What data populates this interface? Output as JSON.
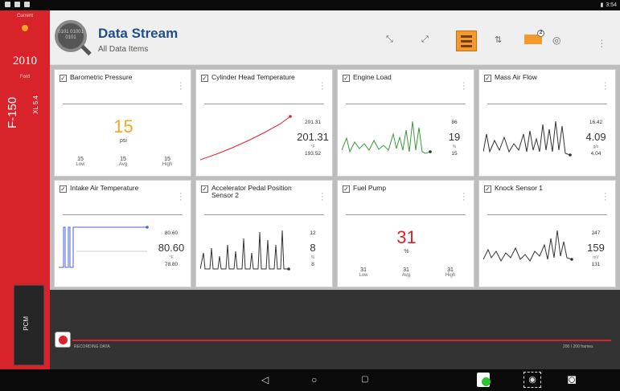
{
  "status_bar": {
    "time": "3:54"
  },
  "sidebar": {
    "current_label": "Current",
    "year": "2010",
    "make": "Ford",
    "model": "F-150",
    "engine": "XL 5.4",
    "module_tab": "PCM"
  },
  "header": {
    "title": "Data Stream",
    "subtitle": "All Data Items",
    "logo_text": "0101 01001 0101",
    "camera_badge": "2"
  },
  "cards": [
    {
      "label": "Barometric Pressure",
      "type": "gauge",
      "value": "15",
      "unit": "psi",
      "low": "15",
      "avg": "15",
      "high": "15",
      "value_color": "#f5a623"
    },
    {
      "label": "Cylinder Head Temperature",
      "type": "graph",
      "max": "201.31",
      "current": "201.31",
      "unit": "°F",
      "min": "193.52",
      "line_color": "#e0222a"
    },
    {
      "label": "Engine Load",
      "type": "graph",
      "max": "86",
      "current": "19",
      "unit": "%",
      "min": "15",
      "line_color": "#3a9a3a"
    },
    {
      "label": "Mass Air Flow",
      "type": "graph",
      "max": "16.42",
      "current": "4.09",
      "unit": "g/s",
      "min": "4.04",
      "line_color": "#333333"
    },
    {
      "label": "Intake Air Temperature",
      "type": "graph",
      "max": "80.60",
      "current": "80.60",
      "unit": "°F",
      "min": "78.80",
      "line_color": "#4a5fd8"
    },
    {
      "label": "Accelerator Pedal Position Sensor 2",
      "type": "graph",
      "max": "12",
      "current": "8",
      "unit": "%",
      "min": "8",
      "line_color": "#333333"
    },
    {
      "label": "Fuel Pump",
      "type": "gauge",
      "value": "31",
      "unit": "%",
      "low": "31",
      "avg": "31",
      "high": "31",
      "value_color": "#e0222a"
    },
    {
      "label": "Knock Sensor 1",
      "type": "graph",
      "max": "247",
      "current": "159",
      "unit": "mV",
      "min": "131",
      "line_color": "#333333"
    }
  ],
  "gauge_labels": {
    "low": "Low",
    "avg": "Avg",
    "high": "High"
  },
  "recorder": {
    "status": "RECORDING DATA",
    "time": "200 / 200 frames"
  },
  "colors": {
    "brand_red": "#d8232a",
    "title_blue": "#1f4e8c",
    "accent_orange": "#f29a2e"
  }
}
